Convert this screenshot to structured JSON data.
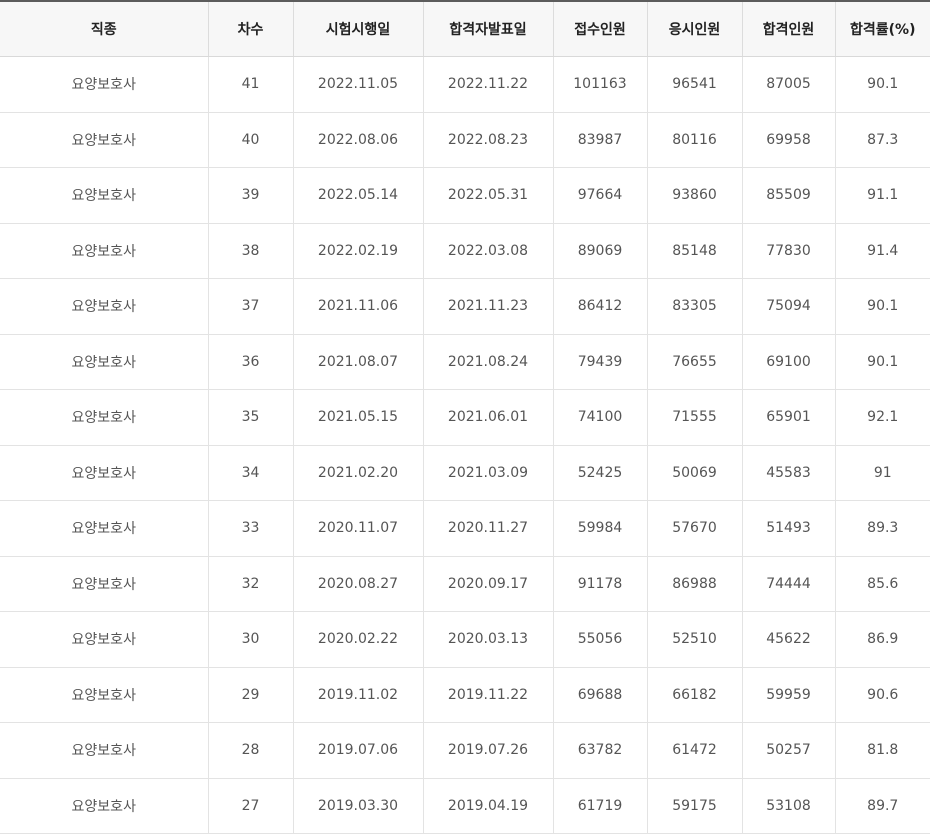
{
  "table": {
    "headers": [
      "직종",
      "차수",
      "시험시행일",
      "합격자발표일",
      "접수인원",
      "응시인원",
      "합격인원",
      "합격률(%)"
    ],
    "rows": [
      [
        "요양보호사",
        "41",
        "2022.11.05",
        "2022.11.22",
        "101163",
        "96541",
        "87005",
        "90.1"
      ],
      [
        "요양보호사",
        "40",
        "2022.08.06",
        "2022.08.23",
        "83987",
        "80116",
        "69958",
        "87.3"
      ],
      [
        "요양보호사",
        "39",
        "2022.05.14",
        "2022.05.31",
        "97664",
        "93860",
        "85509",
        "91.1"
      ],
      [
        "요양보호사",
        "38",
        "2022.02.19",
        "2022.03.08",
        "89069",
        "85148",
        "77830",
        "91.4"
      ],
      [
        "요양보호사",
        "37",
        "2021.11.06",
        "2021.11.23",
        "86412",
        "83305",
        "75094",
        "90.1"
      ],
      [
        "요양보호사",
        "36",
        "2021.08.07",
        "2021.08.24",
        "79439",
        "76655",
        "69100",
        "90.1"
      ],
      [
        "요양보호사",
        "35",
        "2021.05.15",
        "2021.06.01",
        "74100",
        "71555",
        "65901",
        "92.1"
      ],
      [
        "요양보호사",
        "34",
        "2021.02.20",
        "2021.03.09",
        "52425",
        "50069",
        "45583",
        "91"
      ],
      [
        "요양보호사",
        "33",
        "2020.11.07",
        "2020.11.27",
        "59984",
        "57670",
        "51493",
        "89.3"
      ],
      [
        "요양보호사",
        "32",
        "2020.08.27",
        "2020.09.17",
        "91178",
        "86988",
        "74444",
        "85.6"
      ],
      [
        "요양보호사",
        "30",
        "2020.02.22",
        "2020.03.13",
        "55056",
        "52510",
        "45622",
        "86.9"
      ],
      [
        "요양보호사",
        "29",
        "2019.11.02",
        "2019.11.22",
        "69688",
        "66182",
        "59959",
        "90.6"
      ],
      [
        "요양보호사",
        "28",
        "2019.07.06",
        "2019.07.26",
        "63782",
        "61472",
        "50257",
        "81.8"
      ],
      [
        "요양보호사",
        "27",
        "2019.03.30",
        "2019.04.19",
        "61719",
        "59175",
        "53108",
        "89.7"
      ]
    ]
  }
}
